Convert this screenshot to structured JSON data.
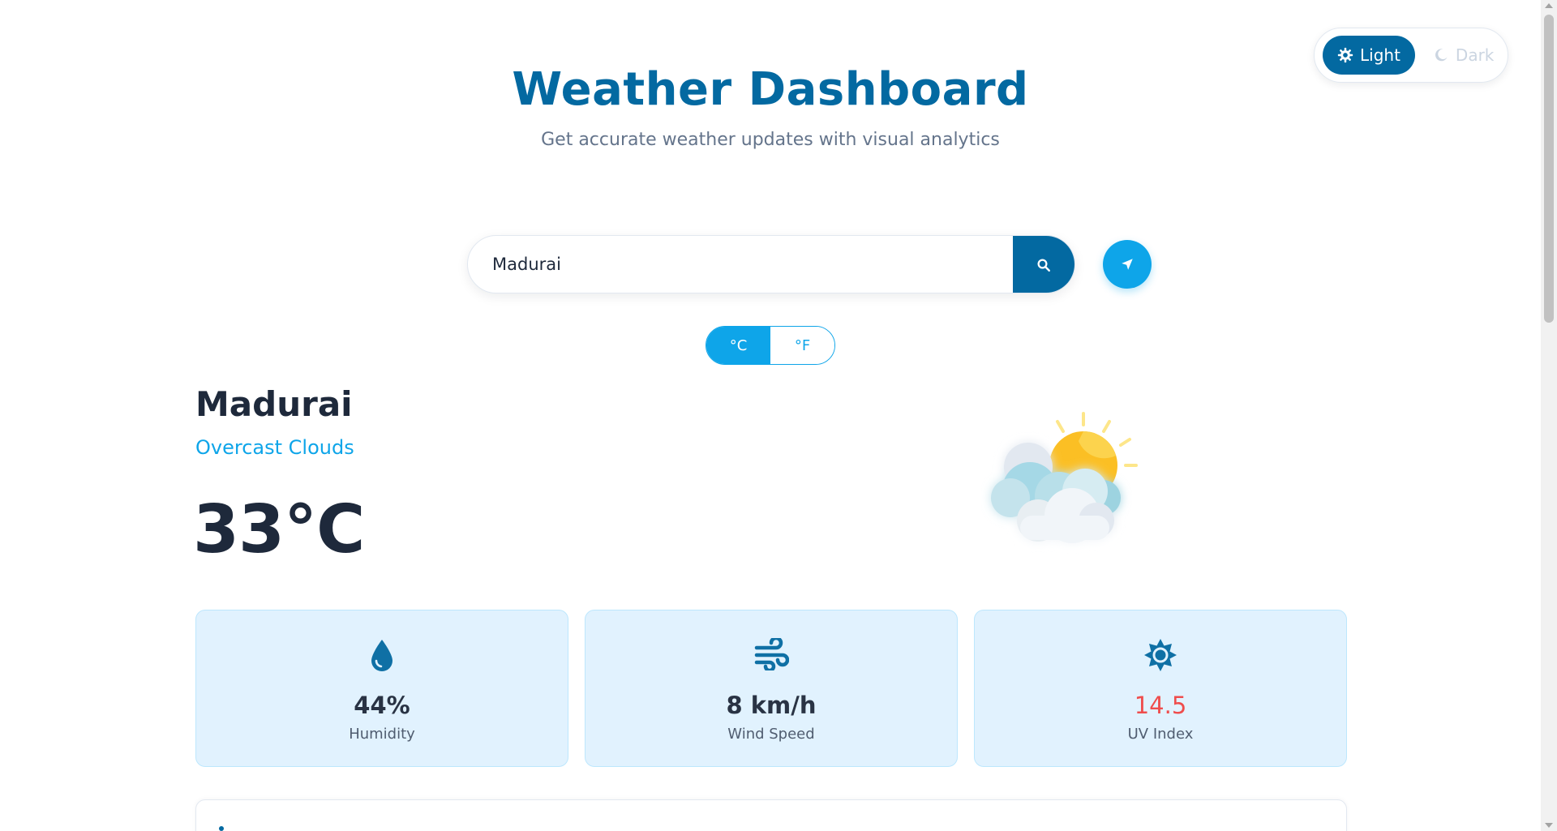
{
  "theme": {
    "light_label": "Light",
    "dark_label": "Dark",
    "active": "light"
  },
  "header": {
    "title": "Weather Dashboard",
    "subtitle": "Get accurate weather updates with visual analytics"
  },
  "search": {
    "value": "Madurai",
    "search_icon": "search-icon",
    "location_icon": "location-arrow-icon"
  },
  "units": {
    "celsius_label": "°C",
    "fahrenheit_label": "°F",
    "active": "celsius"
  },
  "current": {
    "city": "Madurai",
    "condition": "Overcast Clouds",
    "temperature": "33°C",
    "illustration": "sun-behind-clouds-icon"
  },
  "stats": [
    {
      "icon": "droplet-icon",
      "value": "44%",
      "label": "Humidity"
    },
    {
      "icon": "wind-icon",
      "value": "8 km/h",
      "label": "Wind Speed"
    },
    {
      "icon": "sun-icon",
      "value": "14.5",
      "label": "UV Index"
    }
  ],
  "colors": {
    "primary": "#0369a1",
    "accent": "#0ea5e9",
    "card_bg": "#e0f2fe",
    "uv_alert": "#ef4444"
  }
}
